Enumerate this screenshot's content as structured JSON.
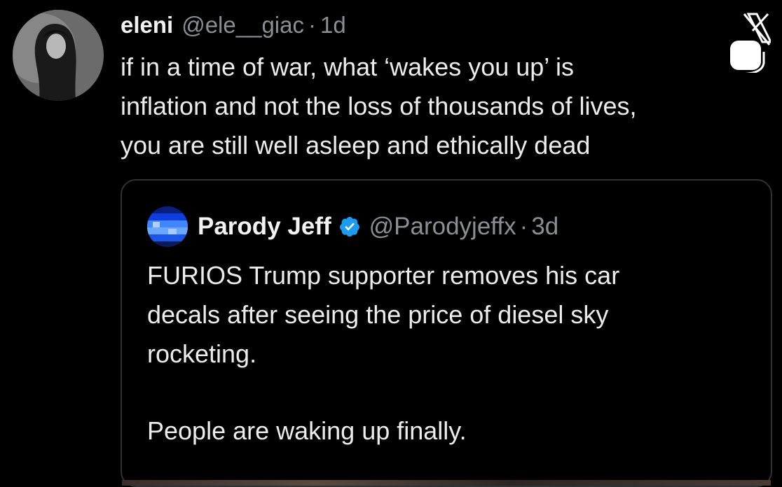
{
  "tweet": {
    "author_name": "eleni",
    "author_handle": "@ele__giac",
    "separator": "·",
    "time": "1d",
    "text": "if in a time of war, what ‘wakes you up’ is\ninflation and not the loss of thousands of lives,\nyou are still well asleep and ethically dead"
  },
  "quoted_tweet": {
    "author_name": "Parody Jeff",
    "author_handle": "@Parodyjeffx",
    "separator": "·",
    "time": "3d",
    "verified": true,
    "text": "FURIOS Trump supporter removes his car\ndecals after seeing the price of diesel sky\nrocketing.",
    "text_2": "People are waking up finally."
  },
  "icons": {
    "platform_logo": "x-logo-icon",
    "verified_badge": "verified-badge-icon"
  },
  "colors": {
    "background": "#000000",
    "text": "#e7e9ea",
    "muted": "#8b8f94",
    "border": "#2f3336",
    "verified": "#1d9bf0"
  }
}
